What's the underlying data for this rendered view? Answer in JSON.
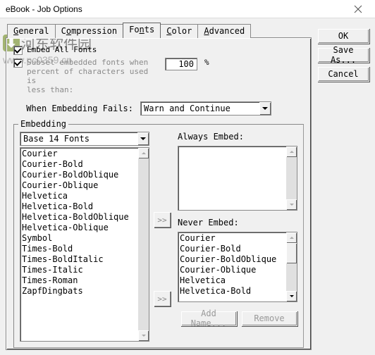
{
  "window": {
    "title": "eBook - Job Options"
  },
  "tabs": {
    "general": "General",
    "compression": "Compression",
    "fonts": "Fonts",
    "color": "Color",
    "advanced": "Advanced"
  },
  "buttons": {
    "ok": "OK",
    "save_as": "Save As...",
    "cancel": "Cancel",
    "add_name": "Add Name...",
    "remove": "Remove"
  },
  "fonts_tab": {
    "embed_all": "Embed All Fonts",
    "subset_label_line1": "Subset embedded fonts when",
    "subset_label_line2": "percent of characters used is",
    "subset_label_line3": "less than:",
    "subset_value": "100",
    "subset_pct": "%",
    "when_fail_label": "When Embedding Fails:",
    "when_fail_value": "Warn and Continue"
  },
  "embedding": {
    "legend": "Embedding",
    "source_select": "Base 14 Fonts",
    "source_list": [
      "Courier",
      "Courier-Bold",
      "Courier-BoldOblique",
      "Courier-Oblique",
      "Helvetica",
      "Helvetica-Bold",
      "Helvetica-BoldOblique",
      "Helvetica-Oblique",
      "Symbol",
      "Times-Bold",
      "Times-BoldItalic",
      "Times-Italic",
      "Times-Roman",
      "ZapfDingbats"
    ],
    "always_label": "Always Embed:",
    "never_label": "Never Embed:",
    "never_list": [
      "Courier",
      "Courier-Bold",
      "Courier-BoldOblique",
      "Courier-Oblique",
      "Helvetica",
      "Helvetica-Bold"
    ]
  },
  "watermark": {
    "text": "河东软件园",
    "url": "www.pc0359.cn"
  }
}
